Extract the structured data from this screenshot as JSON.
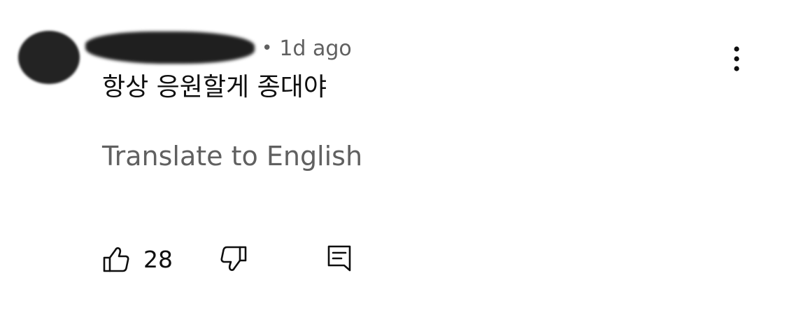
{
  "comment": {
    "author": "",
    "separator": "•",
    "timestamp": "1d ago",
    "text": "항상 응원할게 종대야",
    "translate_label": "Translate to English",
    "like_count": "28"
  },
  "icons": {
    "like": "thumbs-up-icon",
    "dislike": "thumbs-down-icon",
    "reply": "reply-comment-icon",
    "more": "more-vertical-icon"
  },
  "colors": {
    "primary_text": "#0f0f0f",
    "secondary_text": "#606060",
    "background": "#ffffff"
  }
}
